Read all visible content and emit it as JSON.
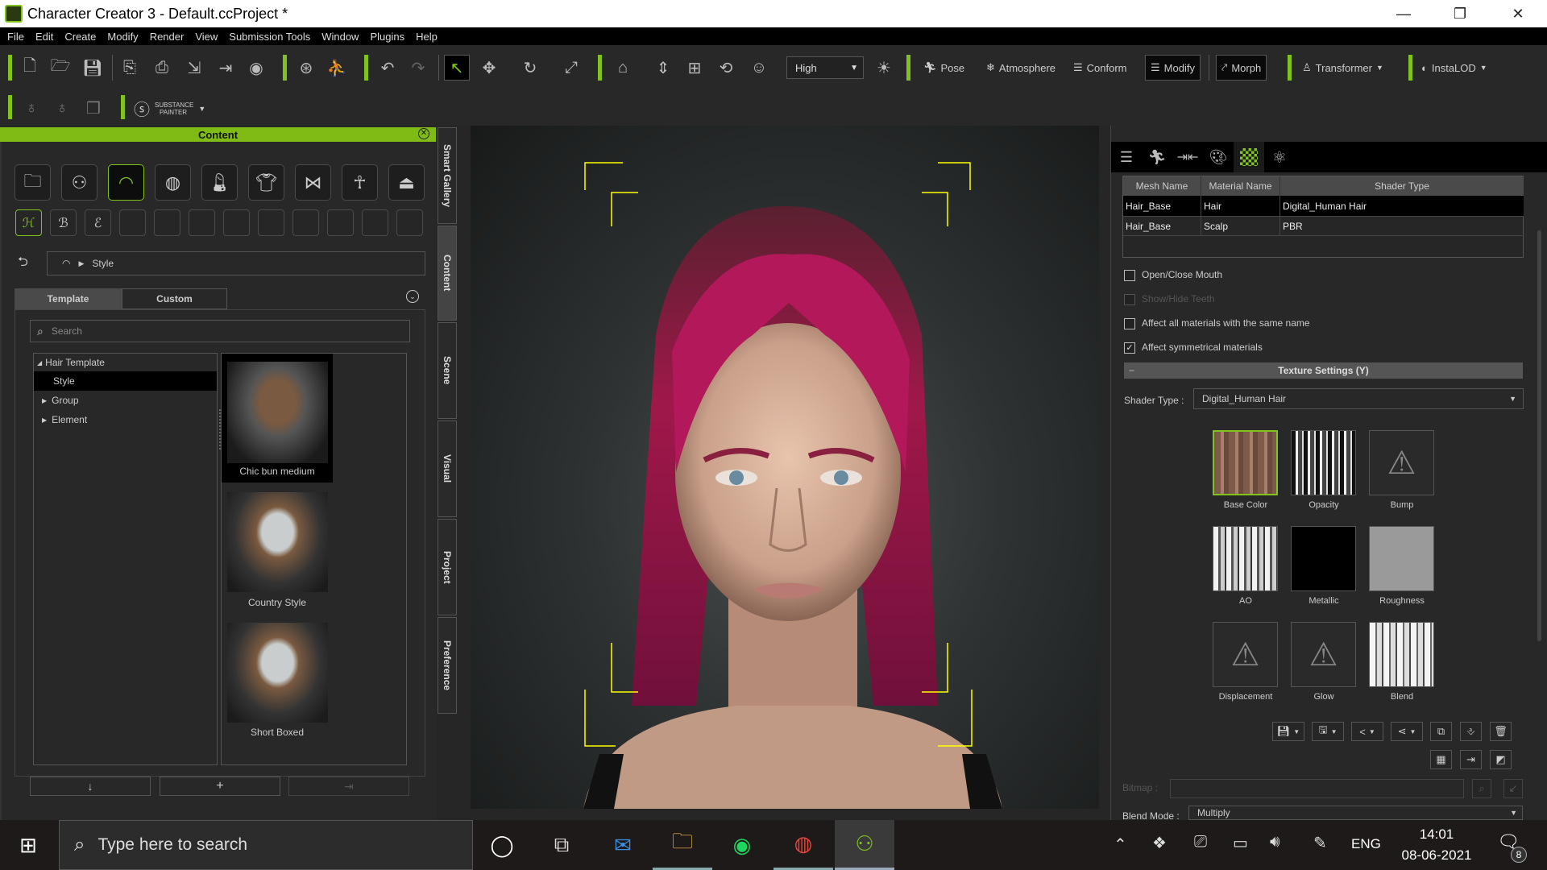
{
  "window": {
    "title": "Character Creator 3 - Default.ccProject *",
    "minimize": "—",
    "restore": "❐",
    "close": "✕"
  },
  "menu": [
    "File",
    "Edit",
    "Create",
    "Modify",
    "Render",
    "View",
    "Submission Tools",
    "Window",
    "Plugins",
    "Help"
  ],
  "toolbar": {
    "quality": "High",
    "pose": "Pose",
    "atmosphere": "Atmosphere",
    "conform": "Conform",
    "modify": "Modify",
    "morph": "Morph",
    "transformer": "Transformer",
    "instalod": "InstaLOD",
    "substance_line1": "SUBSTANCE",
    "substance_line2": "PAINTER"
  },
  "content_panel": {
    "title": "Content",
    "breadcrumb": "Style",
    "tabs": [
      "Template",
      "Custom"
    ],
    "active_tab": "Template",
    "search_placeholder": "Search",
    "tree": [
      {
        "label": "Hair Template",
        "expanded": true,
        "level": 0
      },
      {
        "label": "Style",
        "selected": true,
        "level": 1
      },
      {
        "label": "Group",
        "level": 1
      },
      {
        "label": "Element",
        "level": 1
      }
    ],
    "items": [
      {
        "label": "Chic bun medium",
        "selected": true
      },
      {
        "label": "Country Style"
      },
      {
        "label": "Short Boxed"
      }
    ],
    "bottom_buttons": [
      "↓",
      "+",
      "⇥"
    ]
  },
  "side_tabs": [
    "Smart Gallery",
    "Content",
    "Scene",
    "Visual",
    "Project",
    "Preference"
  ],
  "active_side_tab": "Content",
  "modify_panel": {
    "title": "Modify",
    "table": {
      "headers": [
        "Mesh Name",
        "Material Name",
        "Shader Type"
      ],
      "rows": [
        [
          "Hair_Base",
          "Hair",
          "Digital_Human Hair"
        ],
        [
          "Hair_Base",
          "Scalp",
          "PBR"
        ]
      ],
      "selected_row": 0
    },
    "checkboxes": [
      {
        "label": "Open/Close Mouth",
        "checked": false,
        "enabled": true
      },
      {
        "label": "Show/Hide Teeth",
        "checked": false,
        "enabled": false
      },
      {
        "label": "Affect all materials with the same name",
        "checked": false,
        "enabled": true
      },
      {
        "label": "Affect symmetrical materials",
        "checked": true,
        "enabled": true
      }
    ],
    "section_title": "Texture Settings  (Y)",
    "section_toggle": "−",
    "shader_type_label": "Shader Type :",
    "shader_type_value": "Digital_Human Hair",
    "textures": [
      "Base Color",
      "Opacity",
      "Bump",
      "AO",
      "Metallic",
      "Roughness",
      "Displacement",
      "Glow",
      "Blend"
    ],
    "bitmap_label": "Bitmap :",
    "blend_mode_label": "Blend Mode :",
    "blend_mode_value": "Multiply"
  },
  "taskbar": {
    "search_placeholder": "Type here to search",
    "language": "ENG",
    "time": "14:01",
    "date": "08-06-2021",
    "notifications": "8"
  }
}
